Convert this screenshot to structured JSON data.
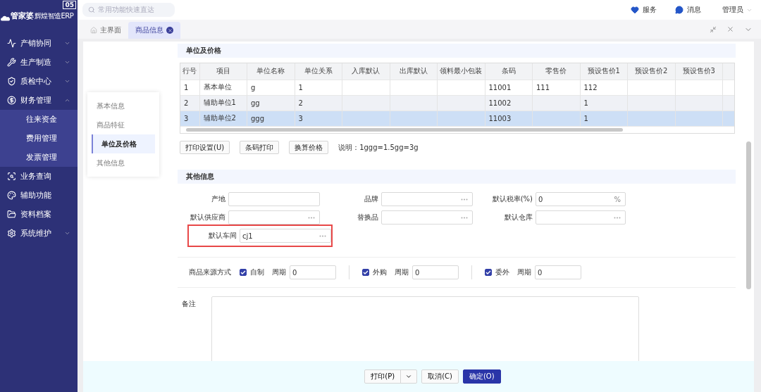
{
  "logo": {
    "name": "管家婆",
    "subtitle": "辉煌智造ERP",
    "badge": "05"
  },
  "search": {
    "placeholder": "常用功能快速直达"
  },
  "header_links": [
    {
      "label": "服务"
    },
    {
      "label": "消息"
    }
  ],
  "user": {
    "name": "管理员"
  },
  "sidebar": {
    "items": [
      {
        "label": "产销协同",
        "expanded": false
      },
      {
        "label": "生产制造",
        "expanded": false
      },
      {
        "label": "质检中心",
        "expanded": false
      },
      {
        "label": "财务管理",
        "expanded": true,
        "children": [
          {
            "label": "往来资金"
          },
          {
            "label": "费用管理"
          },
          {
            "label": "发票管理"
          }
        ]
      },
      {
        "label": "业务查询"
      },
      {
        "label": "辅助功能"
      },
      {
        "label": "资料档案"
      },
      {
        "label": "系统维护",
        "expanded": false
      }
    ]
  },
  "tabs": [
    {
      "label": "主界面",
      "selected": false,
      "kind": "home"
    },
    {
      "label": "商品信息",
      "selected": true,
      "kind": "closable"
    }
  ],
  "section_nav": [
    {
      "label": "基本信息",
      "selected": false
    },
    {
      "label": "商品特征",
      "selected": false
    },
    {
      "label": "单位及价格",
      "selected": true
    },
    {
      "label": "其他信息",
      "selected": false
    }
  ],
  "unit_section": {
    "title": "单位及价格",
    "table": {
      "columns": [
        "行号",
        "项目",
        "单位名称",
        "单位关系",
        "入库默认",
        "出库默认",
        "领料最小包装",
        "条码",
        "零售价",
        "预设售价1",
        "预设售价2",
        "预设售价3"
      ],
      "rows": [
        {
          "selected": false,
          "cells": [
            "1",
            "基本单位",
            "g",
            "1",
            "",
            "",
            "",
            "11001",
            "111",
            "112",
            "",
            ""
          ]
        },
        {
          "selected": false,
          "cells": [
            "2",
            "辅助单位1",
            "gg",
            "2",
            "",
            "",
            "",
            "11002",
            "",
            "1",
            "",
            ""
          ]
        },
        {
          "selected": true,
          "cells": [
            "3",
            "辅助单位2",
            "ggg",
            "3",
            "",
            "",
            "",
            "11003",
            "",
            "1",
            "",
            ""
          ]
        }
      ]
    },
    "buttons": [
      "打印设置(U)",
      "条码打印",
      "换算价格"
    ],
    "note": "说明：1ggg=1.5gg=3g"
  },
  "other_section": {
    "title": "其他信息",
    "fields": [
      {
        "label": "产地",
        "kind": "text"
      },
      {
        "label": "品牌",
        "kind": "lookup"
      },
      {
        "label": "默认税率(%)",
        "kind": "percent",
        "value": "0",
        "suffix": "%"
      },
      {
        "label": "默认供应商",
        "kind": "lookup"
      },
      {
        "label": "替换品",
        "kind": "lookup"
      },
      {
        "label": "默认仓库",
        "kind": "lookup"
      },
      {
        "label": "默认车间",
        "kind": "lookup",
        "value": "cj1",
        "highlighted": true
      }
    ],
    "source": {
      "label": "商品来源方式",
      "options": [
        {
          "label": "自制",
          "checked": true,
          "period_label": "周期",
          "period": "0"
        },
        {
          "label": "外购",
          "checked": true,
          "period_label": "周期",
          "period": "0"
        },
        {
          "label": "委外",
          "checked": true,
          "period_label": "周期",
          "period": "0"
        }
      ]
    },
    "remark": {
      "label": "备注"
    }
  },
  "footer": {
    "buttons": [
      {
        "label": "打印(P)",
        "kind": "split"
      },
      {
        "label": "取消(C)",
        "kind": "default"
      },
      {
        "label": "确定(O)",
        "kind": "primary"
      }
    ]
  }
}
